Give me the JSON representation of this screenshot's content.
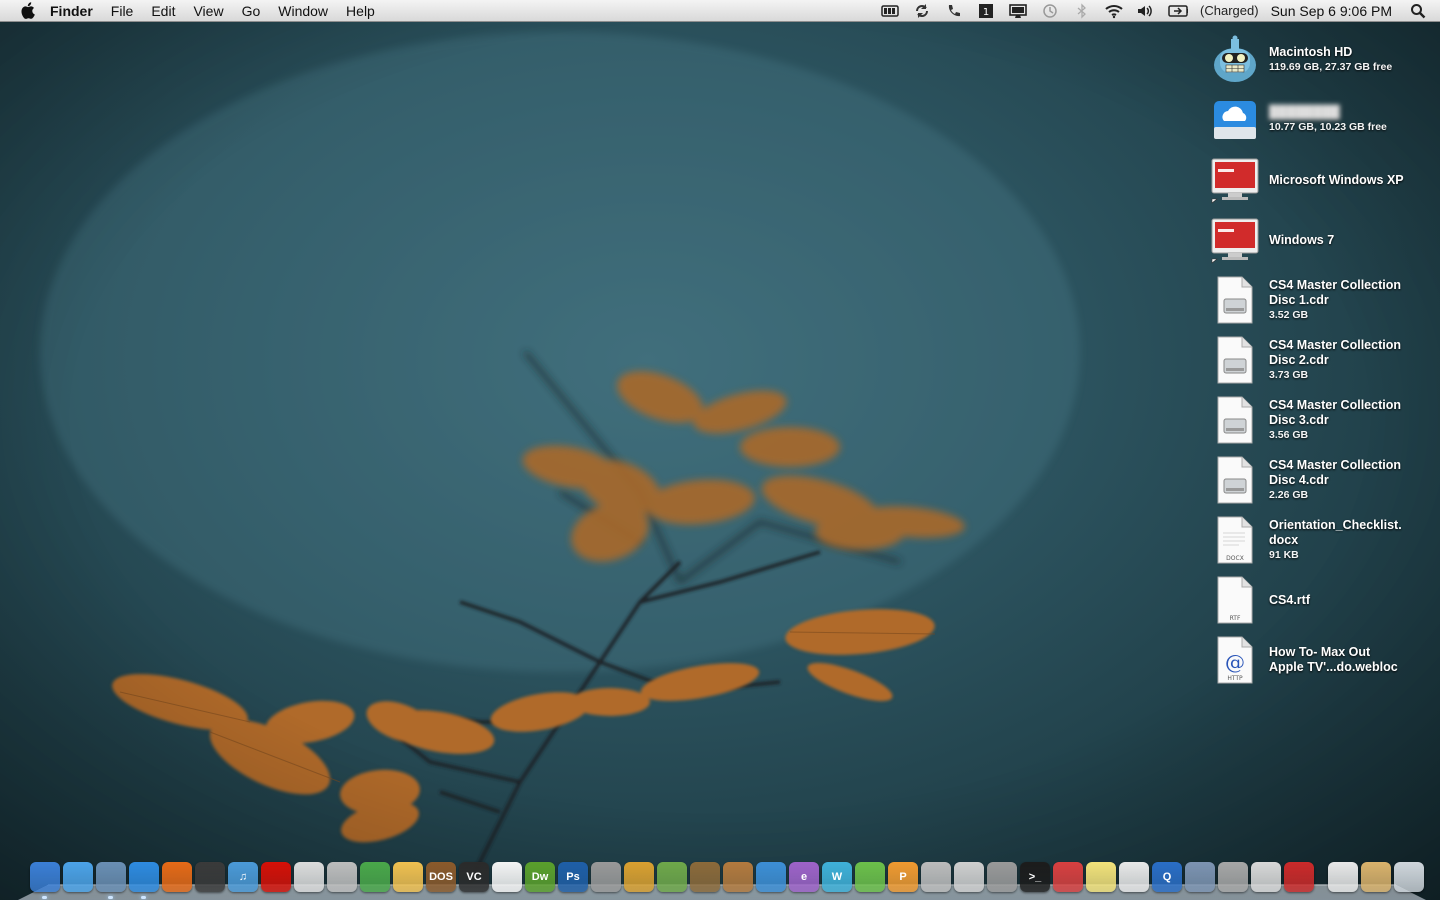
{
  "menubar": {
    "app_name": "Finder",
    "menus": [
      "File",
      "Edit",
      "View",
      "Go",
      "Window",
      "Help"
    ],
    "battery_status": "(Charged)",
    "clock": "Sun Sep 6  9:06 PM",
    "icons": [
      "battery-meter-icon",
      "sync-icon",
      "phone-icon",
      "clipboard-icon",
      "display-icon",
      "time-machine-icon",
      "bluetooth-icon",
      "wifi-icon",
      "volume-icon",
      "battery-icon",
      "spotlight-icon"
    ]
  },
  "desktop": {
    "items": [
      {
        "name": "Macintosh HD",
        "info": "119.69 GB, 27.37 GB free",
        "icon": "bender-drive-icon"
      },
      {
        "name": "",
        "info": "10.77 GB, 10.23 GB free",
        "icon": "cloud-drive-icon"
      },
      {
        "name": "Microsoft Windows XP",
        "info": "",
        "icon": "parallels-vm-icon"
      },
      {
        "name": "Windows 7",
        "info": "",
        "icon": "parallels-vm-icon"
      },
      {
        "name": "CS4 Master Collection Disc 1.cdr",
        "info": "3.52 GB",
        "icon": "disk-image-icon"
      },
      {
        "name": "CS4 Master Collection Disc 2.cdr",
        "info": "3.73 GB",
        "icon": "disk-image-icon"
      },
      {
        "name": "CS4 Master Collection Disc 3.cdr",
        "info": "3.56 GB",
        "icon": "disk-image-icon"
      },
      {
        "name": "CS4 Master Collection Disc 4.cdr",
        "info": "2.26 GB",
        "icon": "disk-image-icon"
      },
      {
        "name": "Orientation_Checklist.docx",
        "info": "91 KB",
        "icon": "docx-file-icon",
        "badge": "DOCX"
      },
      {
        "name": "CS4.rtf",
        "info": "",
        "icon": "rtf-file-icon",
        "badge": "RTF"
      },
      {
        "name": "How To- Max Out Apple TV'...do.webloc",
        "info": "",
        "icon": "webloc-file-icon",
        "badge": "HTTP"
      }
    ]
  },
  "dock": {
    "apps": [
      {
        "id": "finder",
        "color": "#3b7fd6",
        "glyph": "",
        "running": true
      },
      {
        "id": "ichat",
        "color": "#4ca3e8",
        "glyph": "",
        "running": false
      },
      {
        "id": "preview",
        "color": "#6a8fb4",
        "glyph": "",
        "running": true
      },
      {
        "id": "safari",
        "color": "#2e8be0",
        "glyph": "",
        "running": true
      },
      {
        "id": "firefox",
        "color": "#e66a17",
        "glyph": "",
        "running": false
      },
      {
        "id": "istat",
        "color": "#3a3a3a",
        "glyph": "",
        "running": false
      },
      {
        "id": "itunes",
        "color": "#4b9ad8",
        "glyph": "♫",
        "running": false
      },
      {
        "id": "lastfm",
        "color": "#d51007",
        "glyph": "",
        "running": false
      },
      {
        "id": "keychain",
        "color": "#dcdcdc",
        "glyph": "",
        "running": false
      },
      {
        "id": "dvd",
        "color": "#bdbdbd",
        "glyph": "",
        "running": false
      },
      {
        "id": "messenger",
        "color": "#4aa84a",
        "glyph": "",
        "running": false
      },
      {
        "id": "stamps",
        "color": "#f0c050",
        "glyph": "",
        "running": false
      },
      {
        "id": "dosbox",
        "color": "#8b5a2b",
        "glyph": "DOS",
        "running": false
      },
      {
        "id": "vlc",
        "color": "#2b2b2b",
        "glyph": "VC",
        "running": false
      },
      {
        "id": "acrobat",
        "color": "#f4f4f4",
        "glyph": "",
        "running": false
      },
      {
        "id": "dreamweaver",
        "color": "#5aa02c",
        "glyph": "Dw",
        "running": false
      },
      {
        "id": "photoshop",
        "color": "#1f5fa8",
        "glyph": "Ps",
        "running": false
      },
      {
        "id": "xcode",
        "color": "#999999",
        "glyph": "",
        "running": false
      },
      {
        "id": "flash",
        "color": "#d9a030",
        "glyph": "",
        "running": false
      },
      {
        "id": "adium",
        "color": "#6fa84a",
        "glyph": "",
        "running": false
      },
      {
        "id": "iphoto",
        "color": "#8c6a3a",
        "glyph": "",
        "running": false
      },
      {
        "id": "imovie",
        "color": "#b37a3e",
        "glyph": "",
        "running": false
      },
      {
        "id": "transmission",
        "color": "#3d8fd6",
        "glyph": "",
        "running": false
      },
      {
        "id": "app-e",
        "color": "#9e63c9",
        "glyph": "e",
        "running": false
      },
      {
        "id": "app-w",
        "color": "#3fb1d9",
        "glyph": "W",
        "running": false
      },
      {
        "id": "app-x",
        "color": "#6cc04a",
        "glyph": "",
        "running": false
      },
      {
        "id": "app-p",
        "color": "#f09a30",
        "glyph": "P",
        "running": false
      },
      {
        "id": "app-tools",
        "color": "#bcbcbc",
        "glyph": "",
        "running": false
      },
      {
        "id": "calculator",
        "color": "#cfcfcf",
        "glyph": "",
        "running": false
      },
      {
        "id": "utility",
        "color": "#9a9a9a",
        "glyph": "",
        "running": false
      },
      {
        "id": "terminal",
        "color": "#1c1c1c",
        "glyph": "&gt;_",
        "running": false
      },
      {
        "id": "activity",
        "color": "#d84040",
        "glyph": "",
        "running": false
      },
      {
        "id": "stickies",
        "color": "#f2e27a",
        "glyph": "",
        "running": false
      },
      {
        "id": "textedit",
        "color": "#e8e8e8",
        "glyph": "",
        "running": false
      },
      {
        "id": "quicktime",
        "color": "#2a6ec6",
        "glyph": "Q",
        "running": false
      },
      {
        "id": "photos",
        "color": "#7d94b2",
        "glyph": "",
        "running": false
      },
      {
        "id": "sysprefs",
        "color": "#a7a7a7",
        "glyph": "",
        "running": false
      },
      {
        "id": "dvd-drive",
        "color": "#d8d8d8",
        "glyph": "",
        "running": false
      },
      {
        "id": "parallels",
        "color": "#cc2a2a",
        "glyph": "",
        "running": false
      },
      {
        "id": "documents",
        "color": "#e8e8e8",
        "glyph": "",
        "running": false
      },
      {
        "id": "downloads",
        "color": "#d9b26c",
        "glyph": "",
        "running": false
      },
      {
        "id": "trash",
        "color": "#cfd6dc",
        "glyph": "",
        "running": false
      }
    ]
  },
  "colors": {
    "menubar_top": "#f4f4f4",
    "wallpaper_teal": "#2d5561",
    "leaf_orange": "#b06a2a"
  }
}
